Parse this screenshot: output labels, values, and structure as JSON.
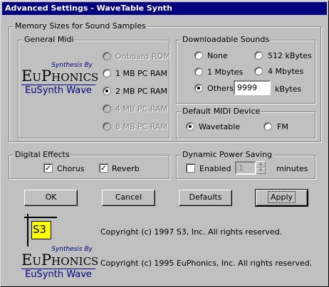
{
  "window": {
    "title": "Advanced Settings - WaveTable Synth"
  },
  "memory_group": {
    "legend": "Memory Sizes for Sound Samples",
    "general_midi": {
      "legend": "General Midi",
      "options": [
        {
          "label": "Onboard ROM",
          "enabled": false,
          "selected": false
        },
        {
          "label": "1 MB PC RAM",
          "enabled": true,
          "selected": false
        },
        {
          "label": "2 MB PC RAM",
          "enabled": true,
          "selected": true
        },
        {
          "label": "4 MB PC RAM",
          "enabled": false,
          "selected": false
        },
        {
          "label": "8 MB PC RAM",
          "enabled": false,
          "selected": false
        }
      ]
    },
    "downloadable": {
      "legend": "Downloadable Sounds",
      "options": [
        {
          "label": "None",
          "selected": false
        },
        {
          "label": "512 kBytes",
          "selected": false
        },
        {
          "label": "1 Mbytes",
          "selected": false
        },
        {
          "label": "4 Mbytes",
          "selected": false
        },
        {
          "label": "Others",
          "selected": true
        }
      ],
      "others_value": "9999",
      "others_unit": "kBytes"
    },
    "default_midi": {
      "legend": "Default MIDI Device",
      "options": [
        {
          "label": "Wavetable",
          "selected": true
        },
        {
          "label": "FM",
          "selected": false
        }
      ]
    }
  },
  "digital_effects": {
    "legend": "Digital Effects",
    "chorus": {
      "label": "Chorus",
      "checked": true
    },
    "reverb": {
      "label": "Reverb",
      "checked": true
    }
  },
  "power_saving": {
    "legend": "Dynamic Power Saving",
    "enabled_label": "Enabled",
    "enabled_checked": false,
    "minutes_value": "1",
    "minutes_label": "minutes"
  },
  "buttons": {
    "ok": "OK",
    "cancel": "Cancel",
    "defaults": "Defaults",
    "apply": "Apply"
  },
  "logos": {
    "euphonics_by": "Synthesis By",
    "euphonics_brand": "EuPhonics",
    "euphonics_sub": "EuSynth Wave",
    "s3_text": "S3"
  },
  "copyrights": {
    "s3": "Copyright (c) 1997  S3, Inc.  All rights reserved.",
    "euphonics": "Copyright (c) 1995  EuPhonics, Inc.  All rights reserved."
  },
  "colors": {
    "title_bar": "#000080",
    "face": "#c0c0c0",
    "s3_logo_bg": "#ffff00",
    "brand_blue": "#000080"
  }
}
